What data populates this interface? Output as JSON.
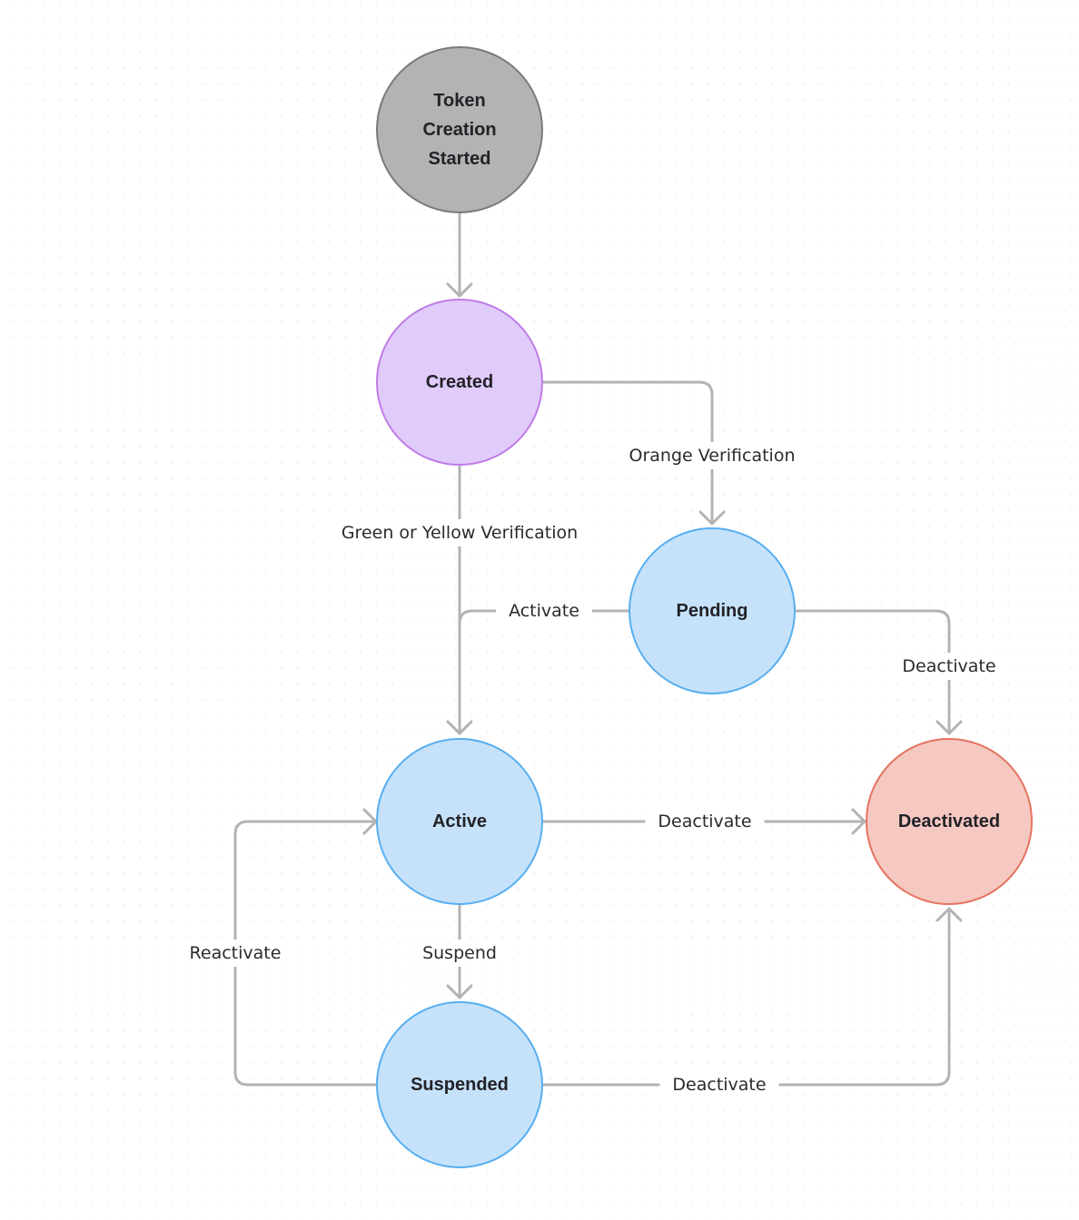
{
  "diagram": {
    "type": "state-machine",
    "colors": {
      "edge": "#b3b3b3",
      "text": "#222228",
      "start_fill": "#b3b3b3",
      "start_stroke": "#7a7a7a",
      "created_fill": "#e1cbfa",
      "created_stroke": "#c07be8",
      "state_fill": "#c6e2fa",
      "state_stroke": "#56aef0",
      "terminal_fill": "#f6c8c2",
      "terminal_stroke": "#e4735f"
    },
    "nodes": [
      {
        "id": "start",
        "label_lines": [
          "Token",
          "Creation",
          "Started"
        ],
        "style": "start"
      },
      {
        "id": "created",
        "label_lines": [
          "Created"
        ],
        "style": "created"
      },
      {
        "id": "pending",
        "label_lines": [
          "Pending"
        ],
        "style": "state"
      },
      {
        "id": "active",
        "label_lines": [
          "Active"
        ],
        "style": "state"
      },
      {
        "id": "deactivated",
        "label_lines": [
          "Deactivated"
        ],
        "style": "terminal"
      },
      {
        "id": "suspended",
        "label_lines": [
          "Suspended"
        ],
        "style": "state"
      }
    ],
    "edges": [
      {
        "id": "start-created",
        "from": "start",
        "to": "created",
        "label": ""
      },
      {
        "id": "created-active",
        "from": "created",
        "to": "active",
        "label": "Green or Yellow Verification"
      },
      {
        "id": "created-pending",
        "from": "created",
        "to": "pending",
        "label": "Orange Verification"
      },
      {
        "id": "pending-active",
        "from": "pending",
        "to": "active",
        "label": "Activate"
      },
      {
        "id": "pending-deactivated",
        "from": "pending",
        "to": "deactivated",
        "label": "Deactivate"
      },
      {
        "id": "active-deactivated",
        "from": "active",
        "to": "deactivated",
        "label": "Deactivate"
      },
      {
        "id": "active-suspended",
        "from": "active",
        "to": "suspended",
        "label": "Suspend"
      },
      {
        "id": "suspended-active",
        "from": "suspended",
        "to": "active",
        "label": "Reactivate"
      },
      {
        "id": "suspended-deactivated",
        "from": "suspended",
        "to": "deactivated",
        "label": "Deactivate"
      }
    ]
  }
}
